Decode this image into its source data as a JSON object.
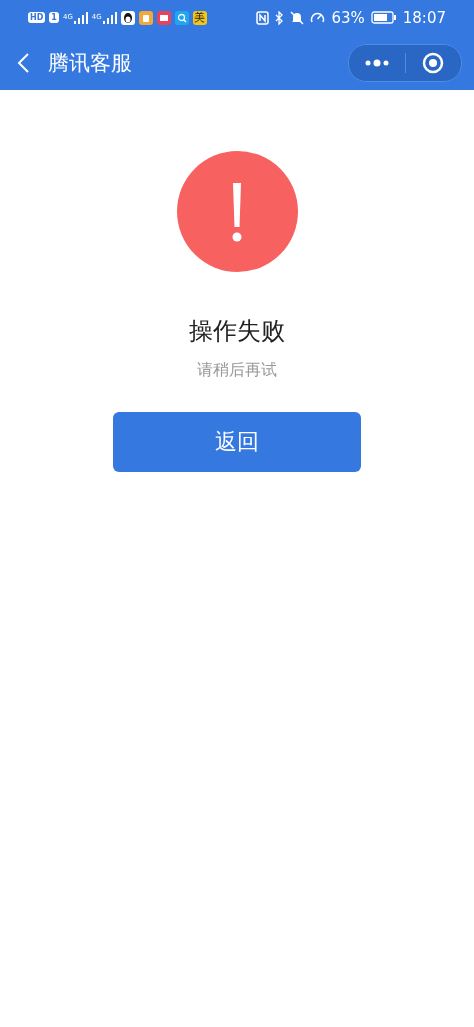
{
  "status_bar": {
    "hd": "HD",
    "sim": "1",
    "signals": [
      "4G",
      "4G"
    ],
    "apps": [
      {
        "kind": "penguin"
      },
      {
        "kind": "cup"
      },
      {
        "kind": "book"
      },
      {
        "kind": "search"
      },
      {
        "kind": "text",
        "label": "美"
      }
    ],
    "battery_text": "63%",
    "time": "18:07"
  },
  "nav": {
    "title": "腾讯客服"
  },
  "result": {
    "kind": "error",
    "title": "操作失败",
    "message": "请稍后再试",
    "button": "返回"
  }
}
